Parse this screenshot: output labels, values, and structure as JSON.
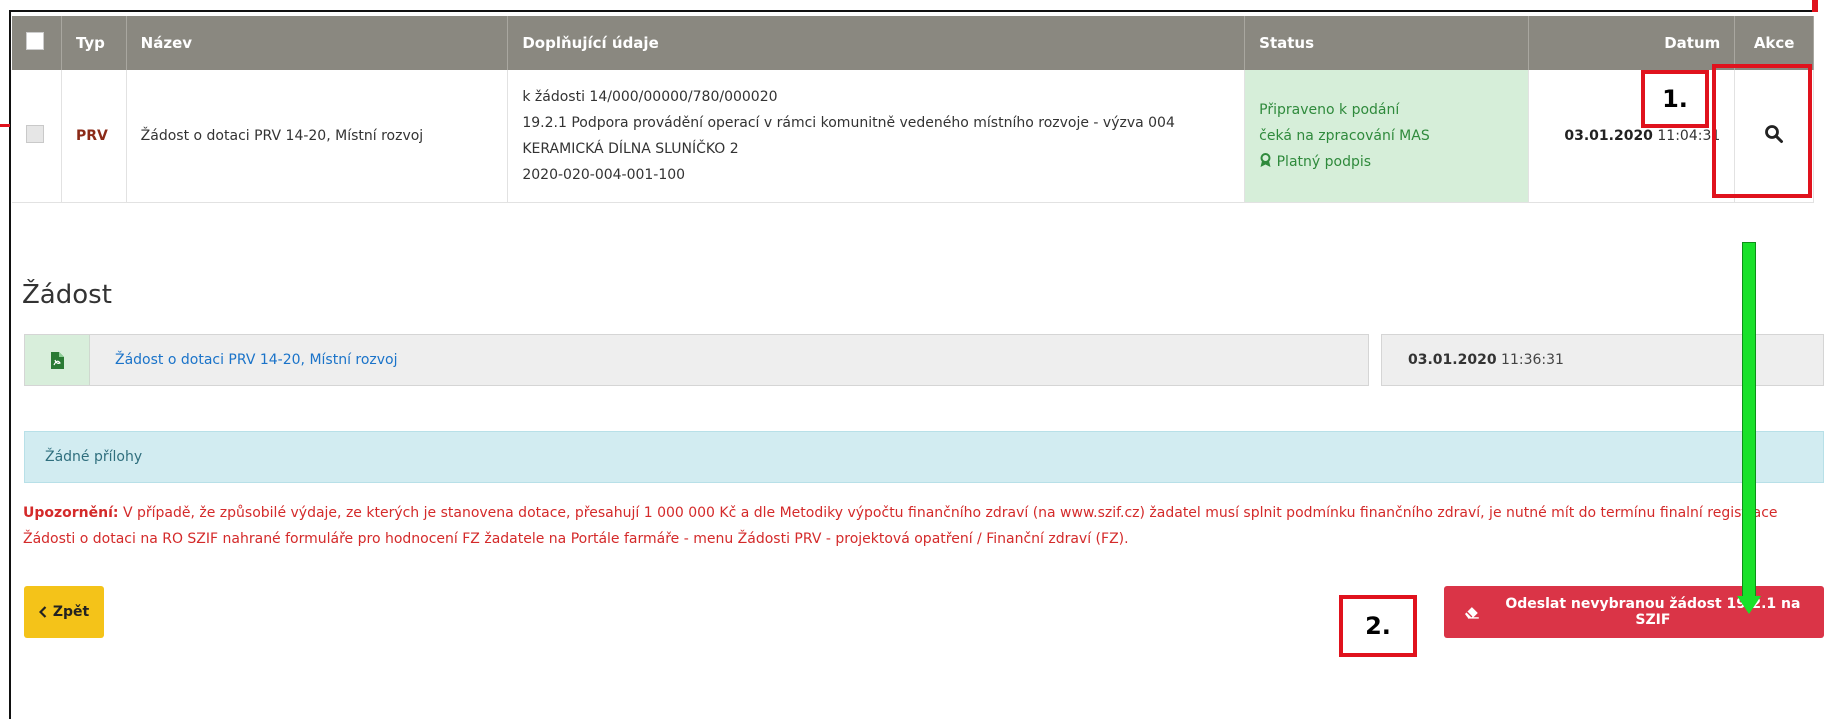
{
  "table": {
    "headers": {
      "typ": "Typ",
      "nazev": "Název",
      "doplnujici": "Doplňující údaje",
      "status": "Status",
      "datum": "Datum",
      "akce": "Akce"
    },
    "row": {
      "typ": "PRV",
      "nazev": "Žádost o dotaci PRV 14-20, Místní rozvoj",
      "doplnujici": [
        "k žádosti 14/000/00000/780/000020",
        "19.2.1 Podpora provádění operací v rámci komunitně vedeného místního rozvoje - výzva 004",
        "KERAMICKÁ DÍLNA SLUNÍČKO 2",
        "2020-020-004-001-100"
      ],
      "status": {
        "line1": "Připraveno k podání",
        "line2": "čeká na zpracování MAS",
        "signature": "Platný podpis"
      },
      "datum_date": "03.01.2020",
      "datum_time": "11:04:31"
    }
  },
  "annotations": {
    "step1": "1.",
    "step2": "2."
  },
  "section": {
    "title": "Žádost",
    "document_link": "Žádost o dotaci PRV 14-20, Místní rozvoj",
    "document_date": "03.01.2020",
    "document_time": "11:36:31"
  },
  "attachments": {
    "empty_text": "Žádné přílohy"
  },
  "warning": {
    "label": "Upozornění:",
    "text": " V případě, že způsobilé výdaje, ze kterých je stanovena dotace, přesahují 1 000 000 Kč a dle Metodiky výpočtu finančního zdraví (na www.szif.cz) žadatel musí splnit podmínku finančního zdraví, je nutné mít do termínu finalní registrace Žádosti o dotaci na RO SZIF nahrané formuláře pro hodnocení FZ žadatele na Portále farmáře - menu Žádosti PRV - projektová opatření / Finanční zdraví (FZ)."
  },
  "buttons": {
    "back": "Zpět",
    "send": "Odeslat nevybranou žádost 19.2.1 na SZIF"
  },
  "colors": {
    "header_bg": "#8a8880",
    "status_bg": "#d6eed9",
    "annotation_red": "#e0121d",
    "arrow_green": "#19e12a",
    "back_button": "#f4c319",
    "send_button": "#da3447",
    "link": "#1a73c9"
  },
  "icons": {
    "search": "search-icon",
    "pdf": "pdf-icon",
    "award": "award-icon",
    "eraser": "eraser-icon",
    "chevron_left": "chevron-left-icon"
  }
}
